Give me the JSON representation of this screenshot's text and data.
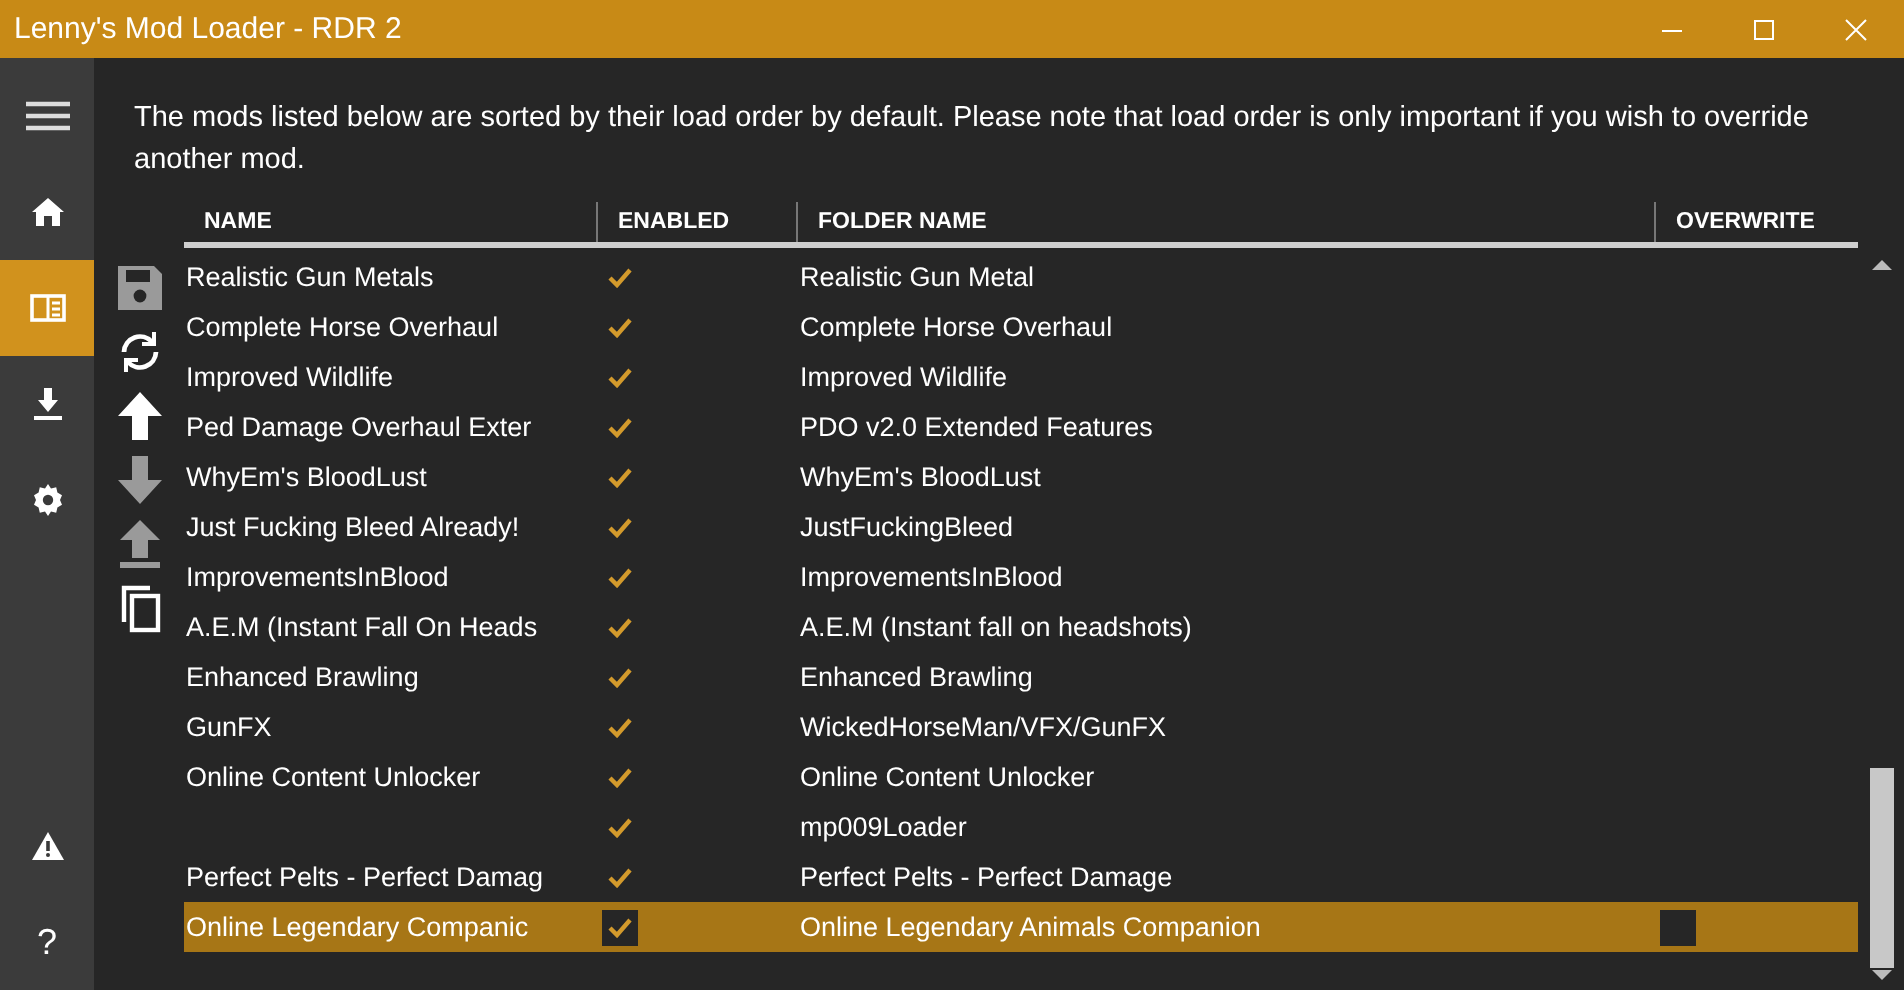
{
  "window": {
    "title": "Lenny's Mod Loader - RDR 2"
  },
  "sidebar": {
    "items": [
      {
        "kind": "menu",
        "selected": false
      },
      {
        "kind": "home",
        "selected": false
      },
      {
        "kind": "mods",
        "selected": true
      },
      {
        "kind": "install",
        "selected": false
      },
      {
        "kind": "settings",
        "selected": false
      }
    ],
    "bottom_items": [
      {
        "kind": "warning"
      },
      {
        "kind": "help",
        "label": "?"
      }
    ]
  },
  "description": "The mods listed below are sorted by their load order by default. Please note that load order is only important if you wish to override another mod.",
  "toolbar": [
    {
      "kind": "save",
      "disabled": true
    },
    {
      "kind": "refresh",
      "disabled": false
    },
    {
      "kind": "move-up",
      "disabled": false
    },
    {
      "kind": "move-down",
      "disabled": true
    },
    {
      "kind": "move-top",
      "disabled": true
    },
    {
      "kind": "copy",
      "disabled": false
    }
  ],
  "table": {
    "columns": [
      "NAME",
      "ENABLED",
      "FOLDER NAME",
      "OVERWRITE"
    ],
    "rows": [
      {
        "name": "Realistic Gun Metals",
        "enabled": true,
        "folder": "Realistic Gun Metal",
        "selected": false
      },
      {
        "name": "Complete Horse Overhaul",
        "enabled": true,
        "folder": "Complete Horse Overhaul",
        "selected": false
      },
      {
        "name": "Improved Wildlife",
        "enabled": true,
        "folder": "Improved Wildlife",
        "selected": false
      },
      {
        "name": "Ped Damage Overhaul Exter",
        "enabled": true,
        "folder": "PDO v2.0 Extended Features",
        "selected": false
      },
      {
        "name": "WhyEm's BloodLust",
        "enabled": true,
        "folder": "WhyEm's BloodLust",
        "selected": false
      },
      {
        "name": "Just Fucking Bleed Already!",
        "enabled": true,
        "folder": "JustFuckingBleed",
        "selected": false
      },
      {
        "name": "ImprovementsInBlood",
        "enabled": true,
        "folder": "ImprovementsInBlood",
        "selected": false
      },
      {
        "name": "A.E.M (Instant Fall On Heads",
        "enabled": true,
        "folder": "A.E.M (Instant fall on headshots)",
        "selected": false
      },
      {
        "name": "Enhanced Brawling",
        "enabled": true,
        "folder": "Enhanced Brawling",
        "selected": false
      },
      {
        "name": "GunFX",
        "enabled": true,
        "folder": "WickedHorseMan/VFX/GunFX",
        "selected": false
      },
      {
        "name": "Online Content Unlocker",
        "enabled": true,
        "folder": "Online Content Unlocker",
        "selected": false
      },
      {
        "enabled": true,
        "folder": "mp009Loader",
        "selected": false
      },
      {
        "name": "Perfect Pelts - Perfect Damag",
        "enabled": true,
        "folder": "Perfect Pelts - Perfect Damage",
        "selected": false
      },
      {
        "name": "Online Legendary Companic",
        "enabled": true,
        "folder": "Online Legendary Animals Companion",
        "selected": true,
        "overwrite": false
      }
    ]
  }
}
